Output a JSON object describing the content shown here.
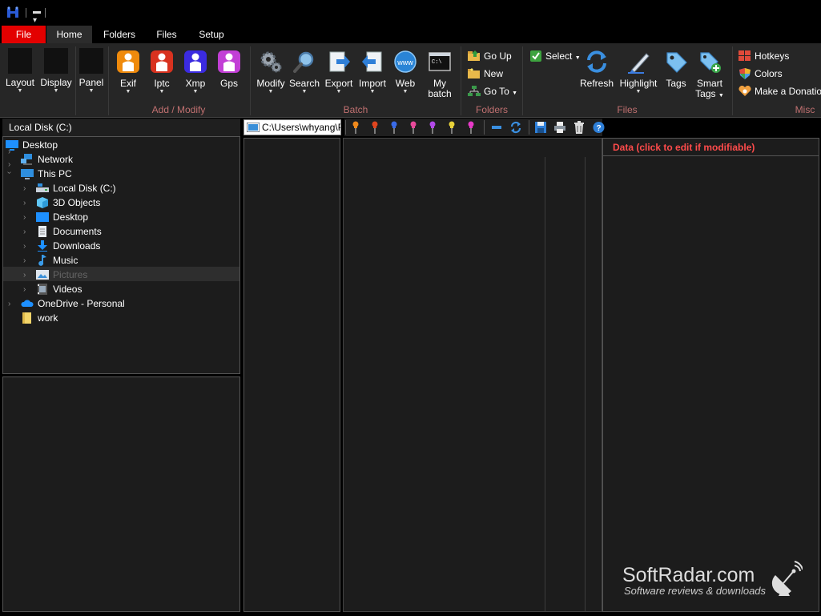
{
  "tabs": [
    {
      "label": "File"
    },
    {
      "label": "Home"
    },
    {
      "label": "Folders"
    },
    {
      "label": "Files"
    },
    {
      "label": "Setup"
    }
  ],
  "ribbon": {
    "layout": "Layout",
    "display": "Display",
    "panel": "Panel",
    "exif": "Exif",
    "iptc": "Iptc",
    "xmp": "Xmp",
    "gps": "Gps",
    "modify": "Modify",
    "search": "Search",
    "export": "Export",
    "import": "Import",
    "web": "Web",
    "my_batch_1": "My",
    "my_batch_2": "batch",
    "go_up": "Go Up",
    "new": "New",
    "go_to": "Go To",
    "select": "Select",
    "refresh": "Refresh",
    "highlight": "Highlight",
    "tags": "Tags",
    "smart_tags_1": "Smart",
    "smart_tags_2": "Tags",
    "hotkeys": "Hotkeys",
    "colors": "Colors",
    "donation": "Make a Donatio",
    "web_icon_text": "www",
    "groups": {
      "add_modify": "Add / Modify",
      "batch": "Batch",
      "folders": "Folders",
      "files": "Files",
      "misc": "Misc"
    }
  },
  "left": {
    "disk_label": "Local Disk (C:)",
    "tree": [
      {
        "label": "Desktop",
        "icon": "desktop-icon"
      },
      {
        "label": "Network",
        "icon": "network-icon"
      },
      {
        "label": "This PC",
        "icon": "computer-icon"
      },
      {
        "label": "Local Disk (C:)",
        "icon": "drive-icon"
      },
      {
        "label": "3D Objects",
        "icon": "cube-icon"
      },
      {
        "label": "Desktop",
        "icon": "desktop-icon"
      },
      {
        "label": "Documents",
        "icon": "document-icon"
      },
      {
        "label": "Downloads",
        "icon": "download-icon"
      },
      {
        "label": "Music",
        "icon": "music-icon"
      },
      {
        "label": "Pictures",
        "icon": "picture-icon"
      },
      {
        "label": "Videos",
        "icon": "video-icon"
      },
      {
        "label": "OneDrive - Personal",
        "icon": "cloud-icon"
      },
      {
        "label": "work",
        "icon": "folder-icon"
      }
    ]
  },
  "middle": {
    "address": "C:\\Users\\whyang\\P"
  },
  "right": {
    "data_header": "Data (click to edit if modifiable)"
  },
  "watermark": {
    "title": "SoftRadar.com",
    "subtitle": "Software reviews & downloads"
  },
  "colors": {
    "file_tab": "#e30000",
    "group_label": "#c07070",
    "data_header": "#ff4b4b"
  }
}
